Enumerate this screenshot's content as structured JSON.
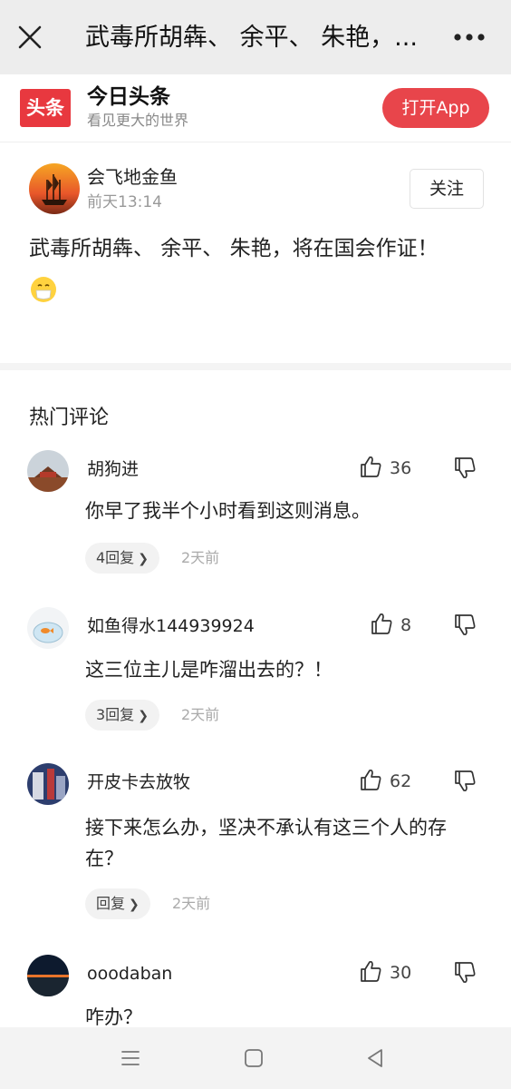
{
  "topbar": {
    "title": "武毒所胡犇、 余平、 朱艳，...",
    "close_icon": "close-icon",
    "more_icon": "more-icon"
  },
  "app_banner": {
    "logo_text": "头条",
    "name": "今日头条",
    "slogan": "看见更大的世界",
    "open_button": "打开App",
    "accent_color": "#e8454b"
  },
  "post": {
    "author": "会飞地金鱼",
    "time": "前天13:14",
    "follow_button": "关注",
    "text": "武毒所胡犇、 余平、 朱艳，将在国会作证！",
    "emoji": "mask-face-emoji"
  },
  "comments_section": {
    "title": "热门评论",
    "comments": [
      {
        "name": "胡狗进",
        "likes": "36",
        "text": "你早了我半个小时看到这则消息。",
        "replies": "4回复",
        "date": "2天前"
      },
      {
        "name": "如鱼得水144939924",
        "likes": "8",
        "text": "这三位主儿是咋溜出去的？！",
        "replies": "3回复",
        "date": "2天前"
      },
      {
        "name": "开皮卡去放牧",
        "likes": "62",
        "text": "接下来怎么办，坚决不承认有这三个人的存在？",
        "replies": "回复",
        "date": "2天前"
      },
      {
        "name": "ooodaban",
        "likes": "30",
        "text": "咋办？",
        "replies": "",
        "date": ""
      }
    ]
  },
  "navbar": {
    "menu_icon": "menu-icon",
    "home_icon": "home-icon",
    "back_icon": "back-icon"
  }
}
